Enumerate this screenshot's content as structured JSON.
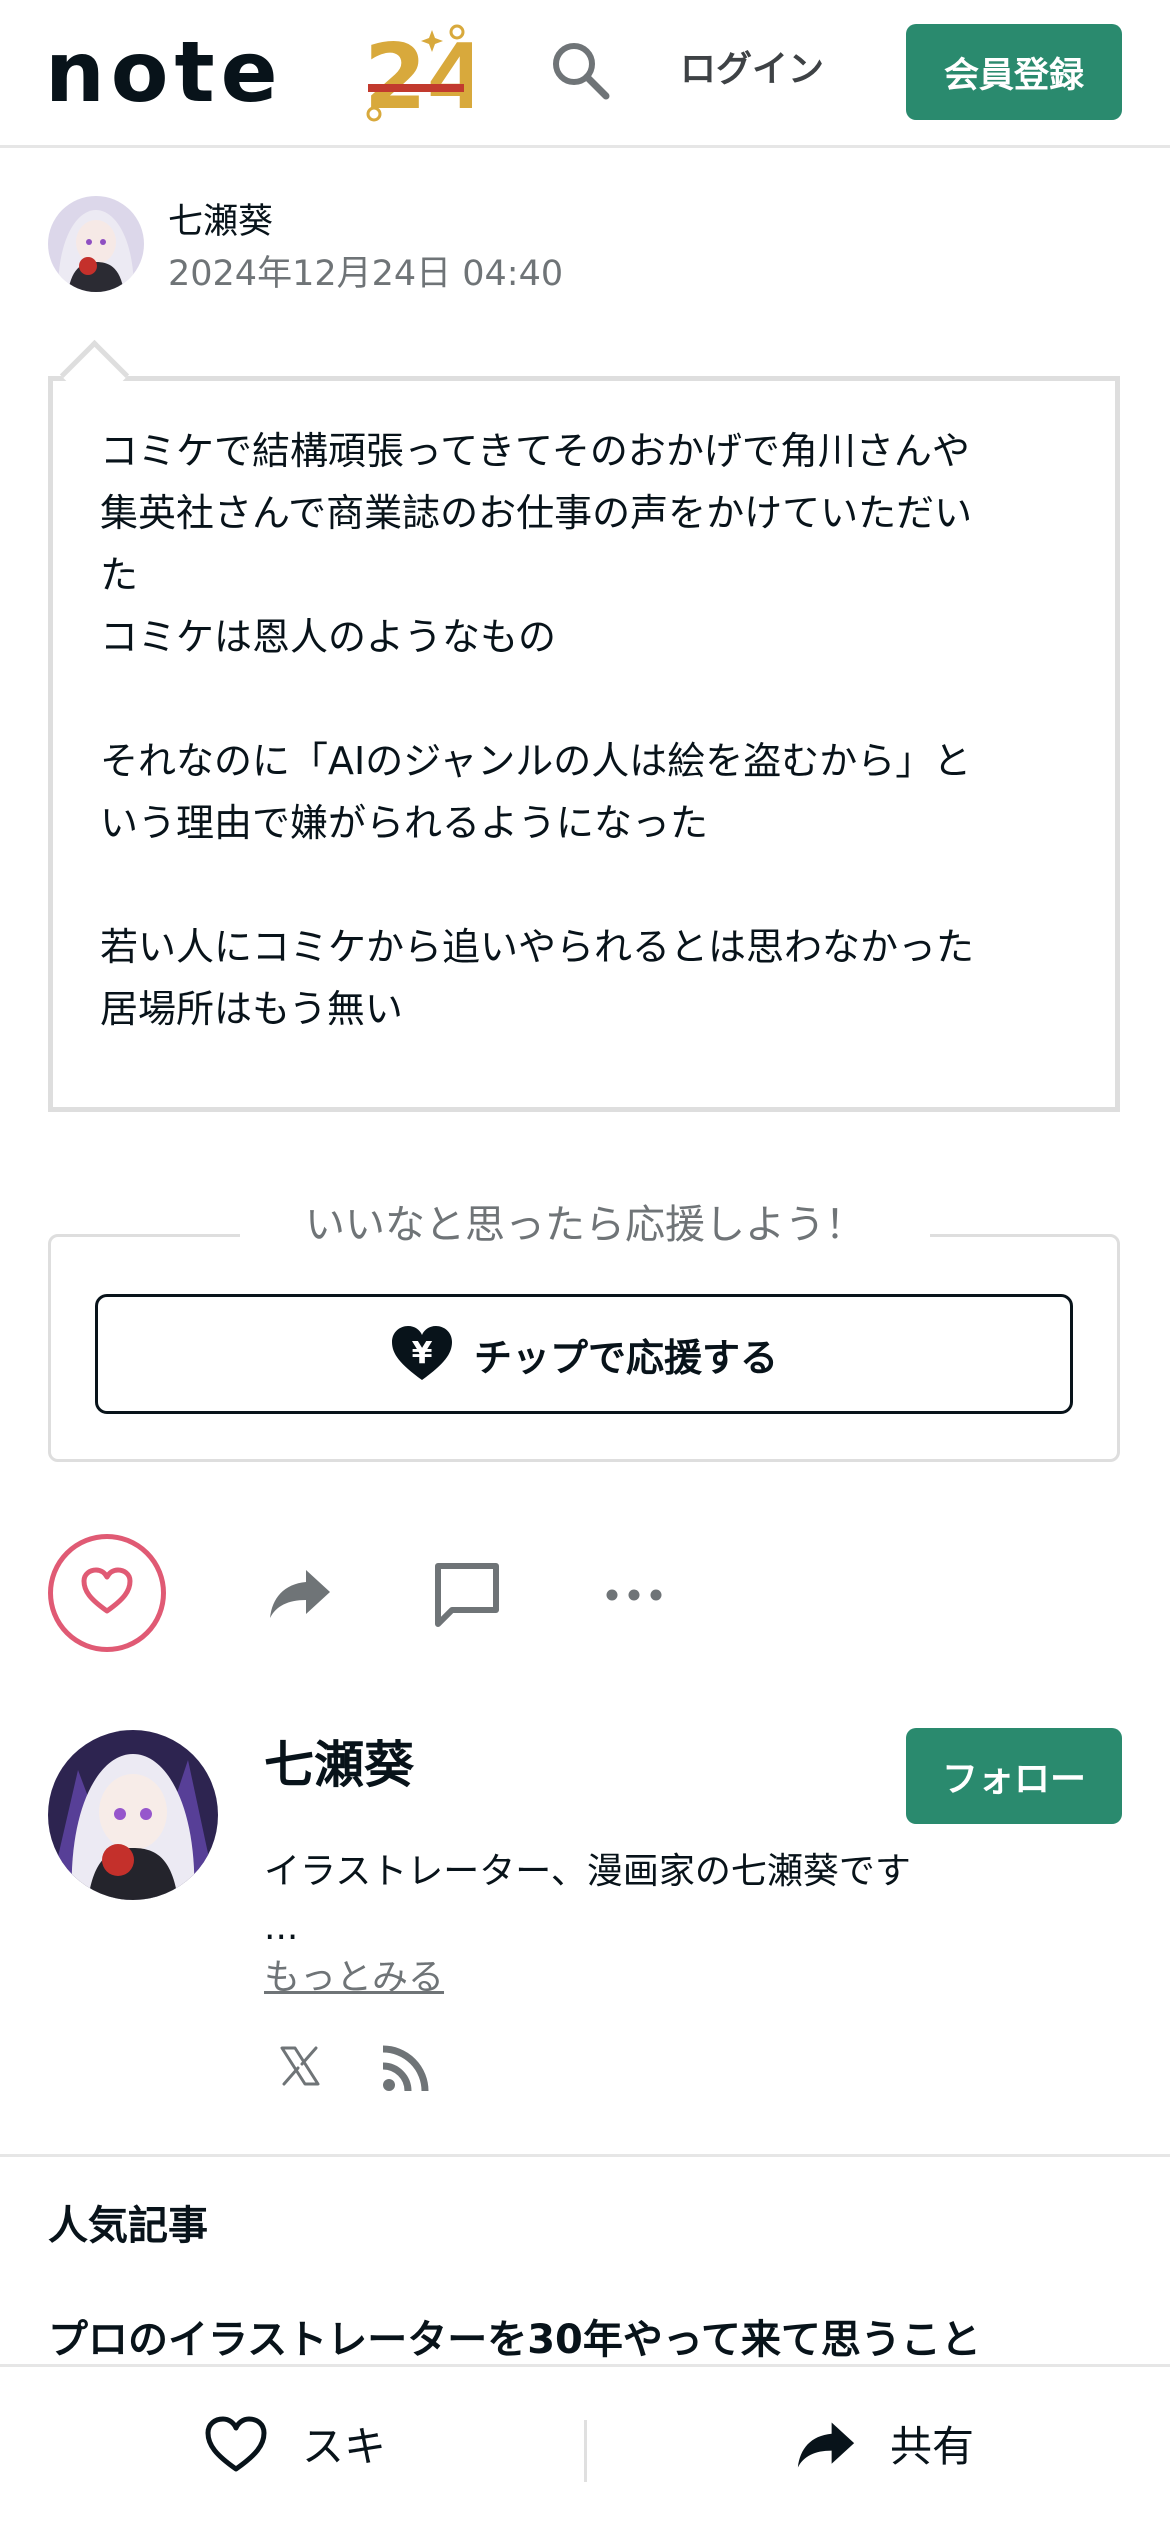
{
  "header": {
    "logo_text": "note",
    "logo_badge": "24",
    "login_label": "ログイン",
    "signup_label": "会員登録"
  },
  "post": {
    "author": "七瀬葵",
    "date": "2024年12月24日 04:40",
    "lines": [
      "コミケで結構頑張ってきてそのおかげで角川さんや",
      "集英社さんで商業誌のお仕事の声をかけていただい",
      "た",
      "コミケは恩人のようなもの",
      "",
      "それなのに「AIのジャンルの人は絵を盗むから」と",
      "いう理由で嫌がられるようになった",
      "",
      "若い人にコミケから追いやられるとは思わなかった",
      "居場所はもう無い"
    ]
  },
  "tip": {
    "caption": "いいなと思ったら応援しよう！",
    "button_label": "チップで応援する"
  },
  "profile": {
    "name": "七瀬葵",
    "follow_label": "フォロー",
    "bio": "イラストレーター、漫画家の七瀬葵です",
    "bio_ellipsis": "...",
    "read_more": "もっとみる"
  },
  "popular": {
    "heading": "人気記事",
    "first_item": "プロのイラストレーターを30年やって来て思うこと"
  },
  "bottom_bar": {
    "like_label": "スキ",
    "share_label": "共有"
  },
  "colors": {
    "brand_green": "#2a8a6e",
    "like_pink": "#e05a74",
    "text": "#08131a",
    "muted": "#6f7477"
  },
  "icons": [
    "search-icon",
    "heart-icon",
    "share-icon",
    "comment-icon",
    "more-icon",
    "x-icon",
    "rss-icon",
    "yen-heart-icon"
  ]
}
